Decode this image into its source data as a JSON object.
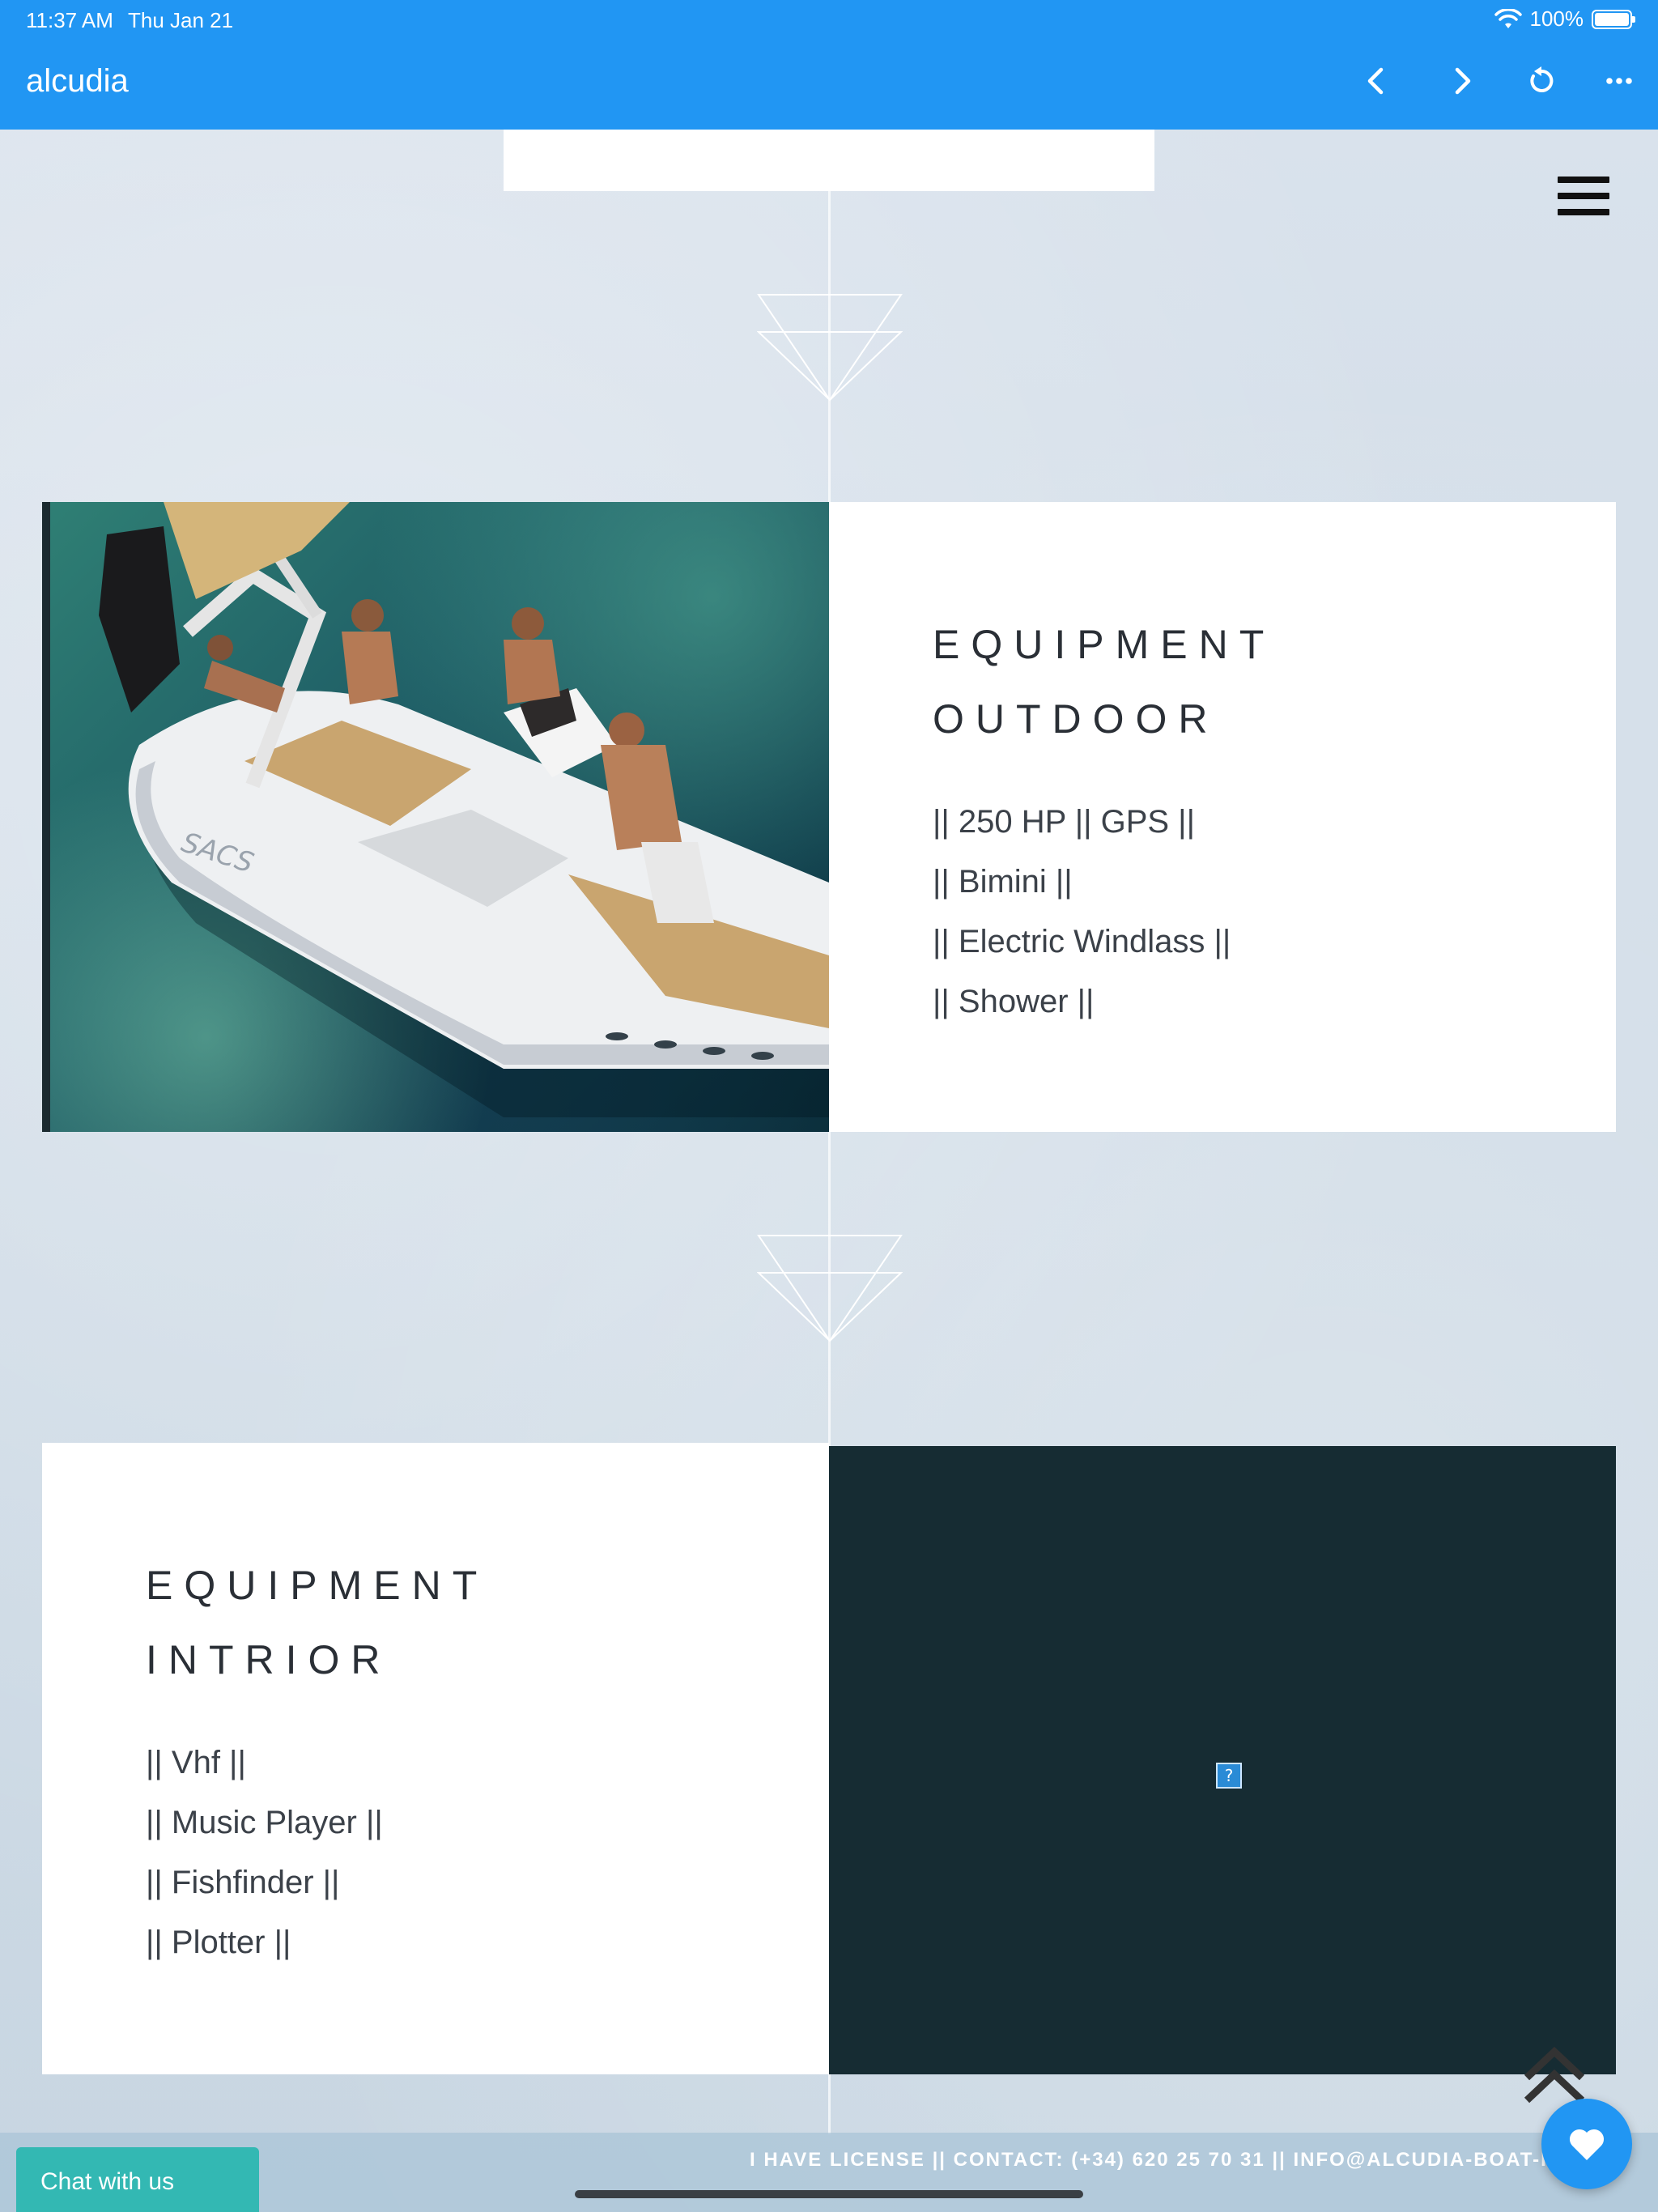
{
  "status_bar": {
    "time": "11:37 AM",
    "date": "Thu Jan 21",
    "battery": "100%"
  },
  "app_bar": {
    "title": "alcudia"
  },
  "icons": {
    "back": "chevron-left-icon",
    "forward": "chevron-right-icon",
    "reload": "reload-icon",
    "more": "more-icon",
    "menu": "hamburger-icon",
    "scroll_top": "double-chevron-up-icon",
    "heart": "heart-icon"
  },
  "colors": {
    "app_bar": "#2196f3",
    "dark_panel": "#162c33",
    "chat_button": "#33b8b3",
    "heart_button": "#2196f3"
  },
  "outdoor": {
    "heading_line1": "EQUIPMENT",
    "heading_line2": "OUTDOOR",
    "items": [
      "|| 250 HP || GPS ||",
      "|| Bimini ||",
      "|| Electric Windlass ||",
      "|| Shower ||"
    ]
  },
  "interior": {
    "heading_line1": "EQUIPMENT",
    "heading_line2": "INTRIOR",
    "items": [
      "|| Vhf ||",
      "|| Music Player ||",
      "|| Fishfinder ||",
      "|| Plotter ||"
    ]
  },
  "broken_image_glyph": "?",
  "footer": {
    "text": "I HAVE LICENSE || CONTACT: (+34) 620 25 70 31 || INFO@ALCUDIA-BOAT-RENT/"
  },
  "chat": {
    "label": "Chat with us"
  }
}
